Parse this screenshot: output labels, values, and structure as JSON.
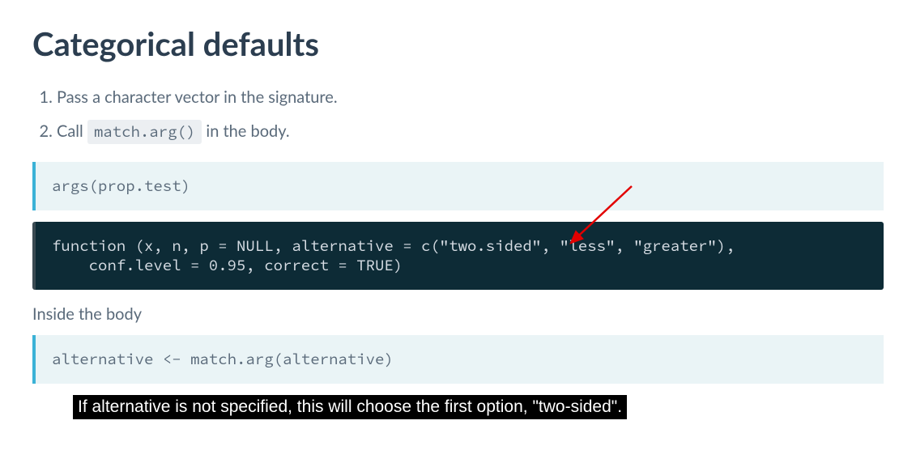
{
  "heading": "Categorical defaults",
  "list": {
    "item1_prefix": "Pass a character vector in the signature.",
    "item2_call": "Call ",
    "item2_code": "match.arg()",
    "item2_suffix": " in the body."
  },
  "code1": "args(prop.test)",
  "code2": "function (x, n, p = NULL, alternative = c(\"two.sided\", \"less\", \"greater\"),\n    conf.level = 0.95, correct = TRUE)",
  "body_text": "Inside the body",
  "code3": "alternative <- match.arg(alternative)",
  "caption": "If alternative is not specified, this will choose the first option, \"two-sided\"."
}
